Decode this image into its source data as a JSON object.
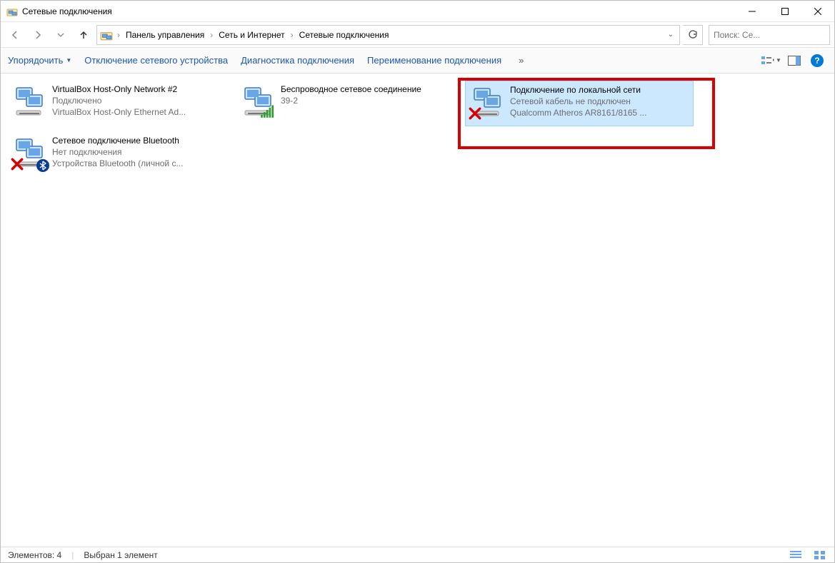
{
  "window": {
    "title": "Сетевые подключения"
  },
  "breadcrumb": {
    "items": [
      "Панель управления",
      "Сеть и Интернет",
      "Сетевые подключения"
    ]
  },
  "search": {
    "placeholder": "Поиск: Се..."
  },
  "toolbar": {
    "organize": "Упорядочить",
    "disable": "Отключение сетевого устройства",
    "diagnose": "Диагностика подключения",
    "rename": "Переименование подключения",
    "more": "»"
  },
  "connections": [
    {
      "name": "VirtualBox Host-Only Network #2",
      "status": "Подключено",
      "device": "VirtualBox Host-Only Ethernet Ad...",
      "kind": "ethernet",
      "disabled": false,
      "selected": false
    },
    {
      "name": "Беспроводное сетевое соединение",
      "status": "39-2",
      "device": "",
      "kind": "wifi",
      "disabled": false,
      "selected": false
    },
    {
      "name": "Подключение по локальной сети",
      "status": "Сетевой кабель не подключен",
      "device": "Qualcomm Atheros AR8161/8165 ...",
      "kind": "ethernet",
      "disabled": true,
      "selected": true
    },
    {
      "name": "Сетевое подключение Bluetooth",
      "status": "Нет подключения",
      "device": "Устройства Bluetooth (личной с...",
      "kind": "bluetooth",
      "disabled": true,
      "selected": false
    }
  ],
  "statusbar": {
    "count_label": "Элементов: 4",
    "selection_label": "Выбран 1 элемент"
  },
  "help_label": "?"
}
